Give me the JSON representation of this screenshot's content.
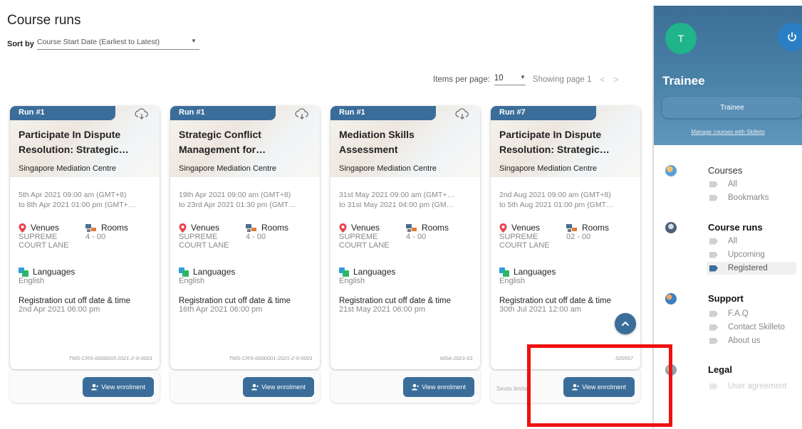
{
  "page_title": "Course runs",
  "sort": {
    "label": "Sort by",
    "value": "Course Start Date (Earliest to Latest)"
  },
  "pager": {
    "items_label": "Items per page:",
    "items_value": "10",
    "showing": "Showing page 1",
    "prev": "<",
    "next": ">"
  },
  "labels": {
    "venues": "Venues",
    "rooms": "Rooms",
    "languages": "Languages",
    "reg_cutoff": "Registration cut off date & time",
    "view_enrolment": "View enrolment",
    "seats_limited": "Seats limited"
  },
  "cards": [
    {
      "run": "Run #1",
      "title": "Participate In Dispute Resolution: Strategic…",
      "org": "Singapore Mediation Centre",
      "date_from": "5th Apr 2021 09:00 am (GMT+8)",
      "date_to": "to 8th Apr 2021 01:00 pm (GMT+…",
      "venue_1": "SUPREME",
      "venue_2": "COURT LANE",
      "room": "4 - 00",
      "language": "English",
      "reg_cutoff": "2nd Apr 2021 06:00 pm",
      "code": "TMS-CRS-0000003-2021-2-9-0001"
    },
    {
      "run": "Run #1",
      "title": "Strategic Conflict Management for…",
      "org": "Singapore Mediation Centre",
      "date_from": "19th Apr 2021 09:00 am (GMT+8)",
      "date_to": "to 23rd Apr 2021 01:30 pm (GMT…",
      "venue_1": "SUPREME",
      "venue_2": "COURT LANE",
      "room": "4 - 00",
      "language": "English",
      "reg_cutoff": "16th Apr 2021 06:00 pm",
      "code": "TMS-CRS-0000001-2021-2-9-0001"
    },
    {
      "run": "Run #1",
      "title": "Mediation Skills Assessment",
      "org": "Singapore Mediation Centre",
      "date_from": "31st May 2021 09:00 am (GMT+…",
      "date_to": "to 31st May 2021 04:00 pm (GM…",
      "venue_1": "SUPREME",
      "venue_2": "COURT LANE",
      "room": "4 - 00",
      "language": "English",
      "reg_cutoff": "21st May 2021 06:00 pm",
      "code": "MSA-2021-01"
    },
    {
      "run": "Run #7",
      "title": "Participate In Dispute Resolution: Strategic…",
      "org": "Singapore Mediation Centre",
      "date_from": "2nd Aug 2021 09:00 am (GMT+8)",
      "date_to": "to 5th Aug 2021 01:00 pm (GMT…",
      "venue_1": "SUPREME",
      "venue_2": "COURT LANE",
      "room": "02 - 00",
      "language": "English",
      "reg_cutoff": "30th Jul 2021 12:00 am",
      "code": "320557"
    }
  ],
  "sidebar": {
    "avatar_letter": "T",
    "role_title": "Trainee",
    "role_button": "Trainee",
    "manage_link": "Manage courses with Skilleto",
    "groups": {
      "courses": {
        "title": "Courses",
        "items": [
          "All",
          "Bookmarks"
        ]
      },
      "course_runs": {
        "title": "Course runs",
        "items": [
          "All",
          "Upcoming",
          "Registered"
        ]
      },
      "support": {
        "title": "Support",
        "items": [
          "F.A.Q",
          "Contact Skilleto",
          "About us"
        ]
      },
      "legal": {
        "title": "Legal",
        "items": [
          "User agreement"
        ]
      }
    }
  },
  "colors": {
    "primary": "#3a6d99",
    "avatar": "#1fb48a",
    "highlight": "#ee1111"
  }
}
